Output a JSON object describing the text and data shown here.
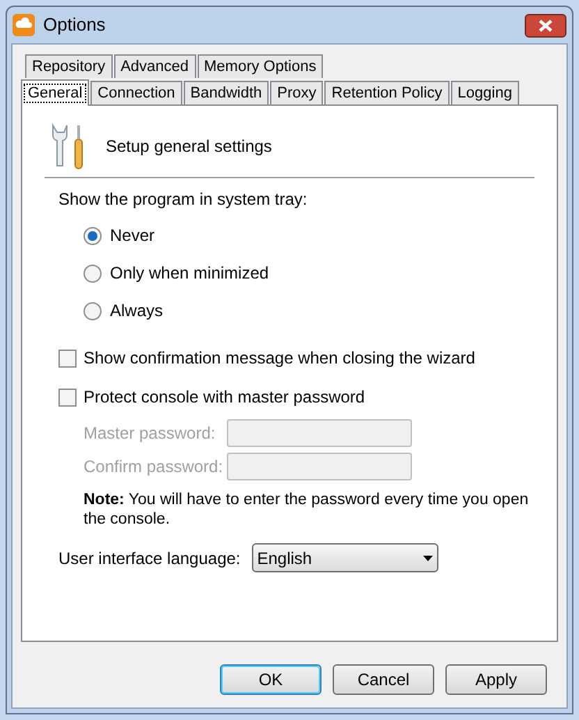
{
  "window": {
    "title": "Options"
  },
  "tab_rows": [
    [
      {
        "label": "Repository",
        "selected": false
      },
      {
        "label": "Advanced",
        "selected": false
      },
      {
        "label": "Memory Options",
        "selected": false
      }
    ],
    [
      {
        "label": "General",
        "selected": true
      },
      {
        "label": "Connection",
        "selected": false
      },
      {
        "label": "Bandwidth",
        "selected": false
      },
      {
        "label": "Proxy",
        "selected": false
      },
      {
        "label": "Retention Policy",
        "selected": false
      },
      {
        "label": "Logging",
        "selected": false
      }
    ]
  ],
  "header": "Setup general settings",
  "tray": {
    "label": "Show the program in system tray:",
    "options": [
      {
        "label": "Never",
        "selected": true
      },
      {
        "label": "Only when minimized",
        "selected": false
      },
      {
        "label": "Always",
        "selected": false
      }
    ]
  },
  "checkboxes": [
    {
      "label": "Show confirmation message when closing the wizard",
      "checked": false
    },
    {
      "label": "Protect console with master password",
      "checked": false
    }
  ],
  "password_fields": [
    {
      "label": "Master password:",
      "disabled": true
    },
    {
      "label": "Confirm password:",
      "disabled": true
    }
  ],
  "note": "**Note:**  You will have to enter the password every time you open the console.",
  "language": {
    "label": "User interface language:",
    "value": "English"
  },
  "buttons": [
    {
      "label": "OK",
      "default": true
    },
    {
      "label": "Cancel",
      "default": false
    },
    {
      "label": "Apply",
      "default": false
    }
  ]
}
